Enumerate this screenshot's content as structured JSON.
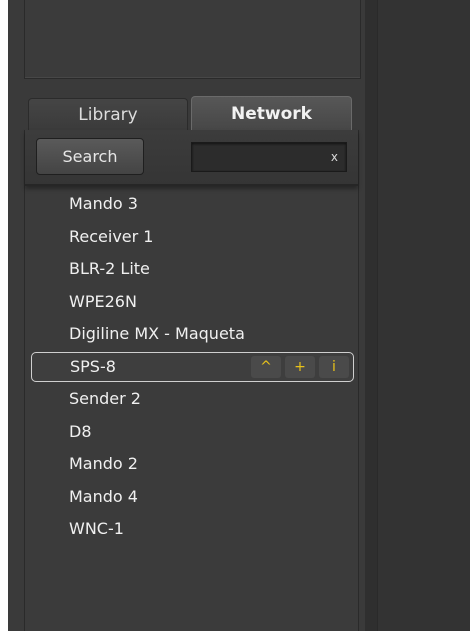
{
  "tabs": {
    "library": "Library",
    "network": "Network"
  },
  "search": {
    "button_label": "Search",
    "value": "",
    "clear_symbol": "x"
  },
  "devices": [
    "Mando 3",
    "Receiver 1",
    "BLR-2 Lite",
    "WPE26N",
    "Digiline MX - Maqueta",
    "SPS-8",
    "Sender 2",
    "D8",
    "Mando 2",
    "Mando 4",
    "WNC-1"
  ],
  "selected_device_index": 5,
  "selected_actions": {
    "up": "^",
    "add": "+",
    "info": "i"
  },
  "colors": {
    "accent": "#e8c21a",
    "panel": "#3b3b3b",
    "background": "#333333"
  }
}
